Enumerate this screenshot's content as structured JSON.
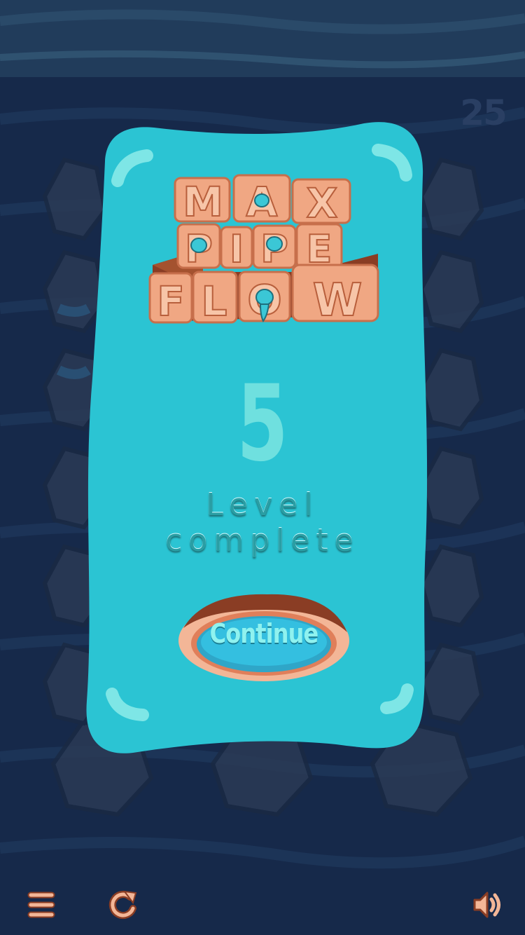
{
  "game": {
    "moves_counter": "25",
    "logo_words": [
      "MAX",
      "PIPE",
      "FLOW"
    ],
    "level_number": "5",
    "status_text": "Level complete",
    "continue_label": "Continue"
  },
  "toolbar": {
    "menu_icon": "hamburger-menu-icon",
    "restart_icon": "restart-arrow-icon",
    "sound_icon": "speaker-icon"
  },
  "colors": {
    "background": "#16294a",
    "panel": "#2bc4d3",
    "logo_block": "#f0a783",
    "accent": "#6fe0df",
    "button_ring": "#f3b697"
  }
}
